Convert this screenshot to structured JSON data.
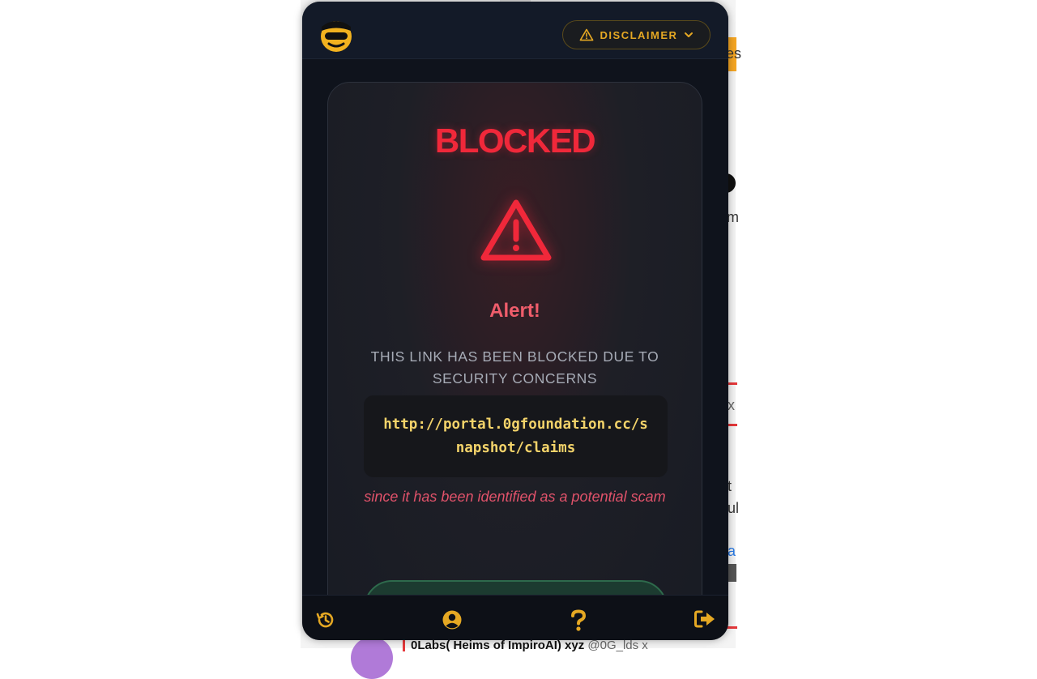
{
  "colors": {
    "accent": "#e5a823",
    "danger": "#f0283a",
    "alert_text": "#ef5d6b",
    "url_text": "#f3d36a",
    "popup_bg": "#0f131c"
  },
  "header": {
    "logo_icon": "masked-face-logo-icon",
    "disclaimer_label": "DISCLAIMER",
    "disclaimer_icon": "warning-triangle-icon",
    "disclaimer_chevron": "chevron-down-icon"
  },
  "card": {
    "status_title": "BLOCKED",
    "status_icon": "warning-triangle-icon",
    "alert_title": "Alert!",
    "message": "THIS LINK HAS BEEN BLOCKED DUE TO SECURITY CONCERNS",
    "url": "http://portal.0gfoundation.cc/snapshot/claims",
    "scam_note": "since it has been identified as a potential scam"
  },
  "footer": {
    "icons": [
      "history-icon",
      "user-circle-icon",
      "question-mark-icon",
      "logout-icon"
    ]
  },
  "background": {
    "fragment_1": "es",
    "fragment_2": "m",
    "fragment_3": "x",
    "fragment_4": "t",
    "fragment_5": "ul",
    "fragment_6": "a",
    "bottom_name": "0Labs( Heims of ImpiroAI) xyz",
    "bottom_handle": "@0G_lds x"
  }
}
